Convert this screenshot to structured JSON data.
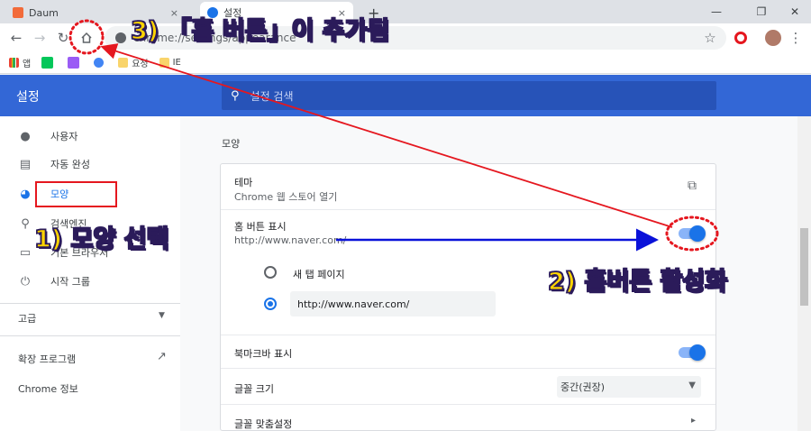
{
  "browser": {
    "tabs": [
      {
        "title": "Daum",
        "close": "×"
      },
      {
        "title": "설정",
        "close": "×"
      }
    ],
    "new_tab": "+",
    "window_controls": {
      "minimize": "—",
      "maximize": "❐",
      "close": "✕"
    },
    "omnibox_text": "chrome://settings/appearance",
    "bookmarks": [
      {
        "label": "앱",
        "icon": "apps-grid-icon"
      },
      {
        "label": "",
        "icon": "naver-n-icon"
      },
      {
        "label": "",
        "icon": "daum-d-icon"
      },
      {
        "label": "",
        "icon": "google-g-icon"
      },
      {
        "label": "요청",
        "icon": "folder-icon"
      },
      {
        "label": "IE",
        "icon": "folder-icon"
      }
    ]
  },
  "settings": {
    "title": "설정",
    "search_placeholder": "설정 검색",
    "sidebar": {
      "items": [
        {
          "label": "사용자",
          "icon": "person-icon"
        },
        {
          "label": "자동 완성",
          "icon": "clipboard-icon"
        },
        {
          "label": "모양",
          "icon": "palette-icon",
          "selected": true
        },
        {
          "label": "검색엔진",
          "icon": "search-icon"
        },
        {
          "label": "기본 브라우저",
          "icon": "browser-icon"
        },
        {
          "label": "시작 그룹",
          "icon": "power-icon"
        }
      ],
      "advanced": "고급",
      "extensions": "확장 프로그램",
      "about": "Chrome 정보"
    },
    "section_title": "모양",
    "rows": {
      "theme_label": "테마",
      "theme_sub": "Chrome 웹 스토어 열기",
      "home_label": "홈 버튼 표시",
      "home_sub": "http://www.naver.com/",
      "home_enabled": true,
      "radio_newtab": "새 탭 페이지",
      "radio_custom_value": "http://www.naver.com/",
      "bookmark_bar_label": "북마크바 표시",
      "bookmark_bar_enabled": true,
      "font_size_label": "글꼴 크기",
      "font_size_value": "중간(권장)",
      "custom_fonts_label": "글꼴 맞춤설정"
    }
  },
  "annotations": {
    "step1": "1) 모양 선택",
    "step2": "2) 홈버튼 활성화",
    "step3": "3) 「홈 버튼」이 추가됨",
    "arrow_red_color": "#e5171f",
    "arrow_blue_color": "#0a12d9",
    "highlight_color": "#e5171f"
  }
}
